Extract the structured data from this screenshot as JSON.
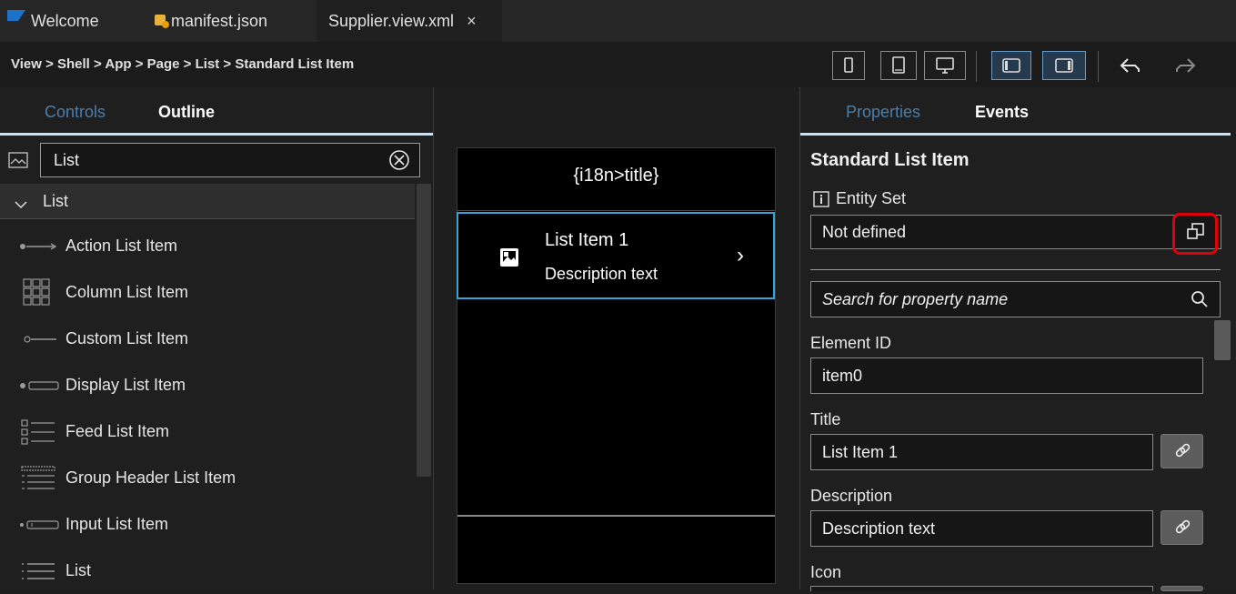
{
  "tabs": [
    {
      "label": "Welcome"
    },
    {
      "label": "manifest.json"
    },
    {
      "label": "Supplier.view.xml",
      "close": "×"
    }
  ],
  "breadcrumb": "View > Shell > App > Page > List > Standard List Item",
  "left_panel": {
    "tabs": [
      {
        "label": "Controls"
      },
      {
        "label": "Outline"
      }
    ],
    "search_value": "List",
    "group_label": "List",
    "items": [
      {
        "label": "Action List Item",
        "icon": "action-list-item-icon"
      },
      {
        "label": "Column List Item",
        "icon": "column-list-item-icon"
      },
      {
        "label": "Custom List Item",
        "icon": "custom-list-item-icon"
      },
      {
        "label": "Display List Item",
        "icon": "display-list-item-icon"
      },
      {
        "label": "Feed List Item",
        "icon": "feed-list-item-icon"
      },
      {
        "label": "Group Header List Item",
        "icon": "group-header-list-item-icon"
      },
      {
        "label": "Input List Item",
        "icon": "input-list-item-icon"
      },
      {
        "label": "List",
        "icon": "list-icon"
      }
    ]
  },
  "canvas": {
    "page_title": "{i18n>title}",
    "list_item_title": "List Item 1",
    "list_item_description": "Description text",
    "chevron": "›"
  },
  "right_panel": {
    "tabs": [
      {
        "label": "Properties"
      },
      {
        "label": "Events"
      }
    ],
    "control_name": "Standard List Item",
    "entity_set_label": "Entity Set",
    "entity_set_value": "Not defined",
    "search_placeholder": "Search for property name",
    "element_id_label": "Element ID",
    "element_id_value": "item0",
    "title_label": "Title",
    "title_value": "List Item 1",
    "description_label": "Description",
    "description_value": "Description text",
    "icon_label": "Icon"
  },
  "colors": {
    "accent": "#4b7faa",
    "selection_border": "#39a3d8",
    "highlight": "#e0000c"
  }
}
